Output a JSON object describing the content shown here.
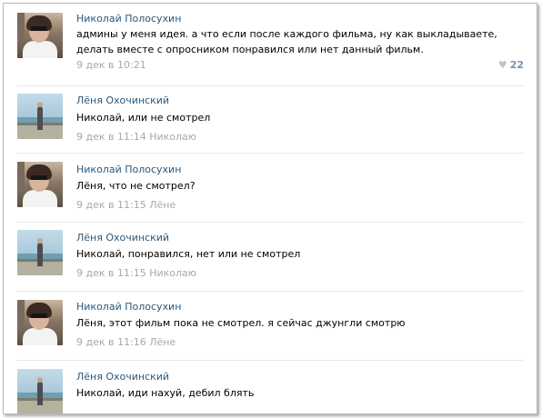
{
  "comments": [
    {
      "author": "Николай Полосухин",
      "avatar": "nikolay",
      "text": "админы у меня идея. а что если после каждого фильма, ну как выкладываете, делать вместе с опросником понравился или нет данный фильм.",
      "date": "9 дек в 10:21",
      "reply_to": "",
      "likes": "22",
      "like_icon": "heart-icon"
    },
    {
      "author": "Лёня Охочинский",
      "avatar": "lyonya",
      "text": "Николай, или не смотрел",
      "date": "9 дек в 11:14",
      "reply_to": "Николаю"
    },
    {
      "author": "Николай Полосухин",
      "avatar": "nikolay",
      "text": "Лёня, что не смотрел?",
      "date": "9 дек в 11:15",
      "reply_to": "Лёне"
    },
    {
      "author": "Лёня Охочинский",
      "avatar": "lyonya",
      "text": "Николай, понравился, нет или не смотрел",
      "date": "9 дек в 11:15",
      "reply_to": "Николаю"
    },
    {
      "author": "Николай Полосухин",
      "avatar": "nikolay",
      "text": "Лёня, этот фильм пока не смотрел. я сейчас джунгли смотрю",
      "date": "9 дек в 11:16",
      "reply_to": "Лёне"
    },
    {
      "author": "Лёня Охочинский",
      "avatar": "lyonya",
      "text": "Николай, иди нахуй, дебил блять",
      "date": "",
      "reply_to": ""
    }
  ],
  "colors": {
    "author": "#2b587a",
    "meta": "#a3a9b0",
    "divider": "#e7eaee"
  }
}
